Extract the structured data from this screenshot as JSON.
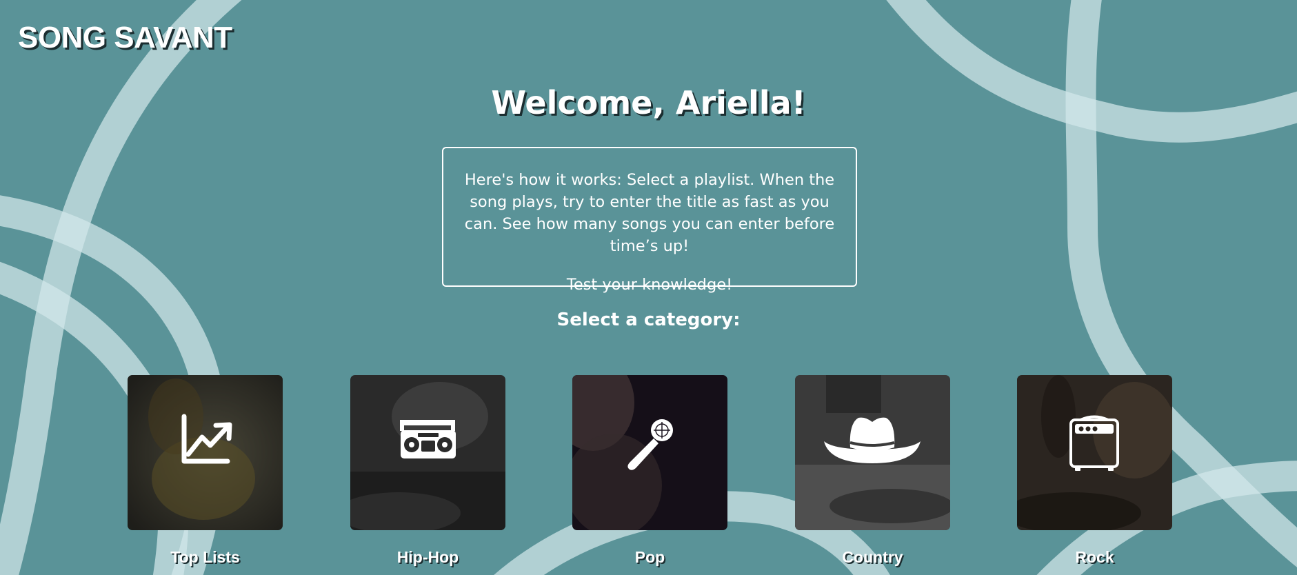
{
  "app": {
    "title": "SONG SAVANT"
  },
  "welcome": {
    "heading": "Welcome, Ariella!"
  },
  "instructions": {
    "body": "Here's how it works: Select a playlist. When the song plays, try to enter the title as fast as you can. See how many songs you can enter before time’s up!",
    "tagline": "Test your knowledge!"
  },
  "categories": {
    "heading": "Select a category:",
    "items": [
      {
        "label": "Top Lists",
        "icon": "trending-chart-icon"
      },
      {
        "label": "Hip-Hop",
        "icon": "boombox-icon"
      },
      {
        "label": "Pop",
        "icon": "microphone-icon"
      },
      {
        "label": "Country",
        "icon": "cowboy-hat-icon"
      },
      {
        "label": "Rock",
        "icon": "guitar-amp-icon"
      }
    ]
  },
  "colors": {
    "background": "#5a9398",
    "swirl": "#c9e2e4",
    "text": "#ffffff"
  }
}
